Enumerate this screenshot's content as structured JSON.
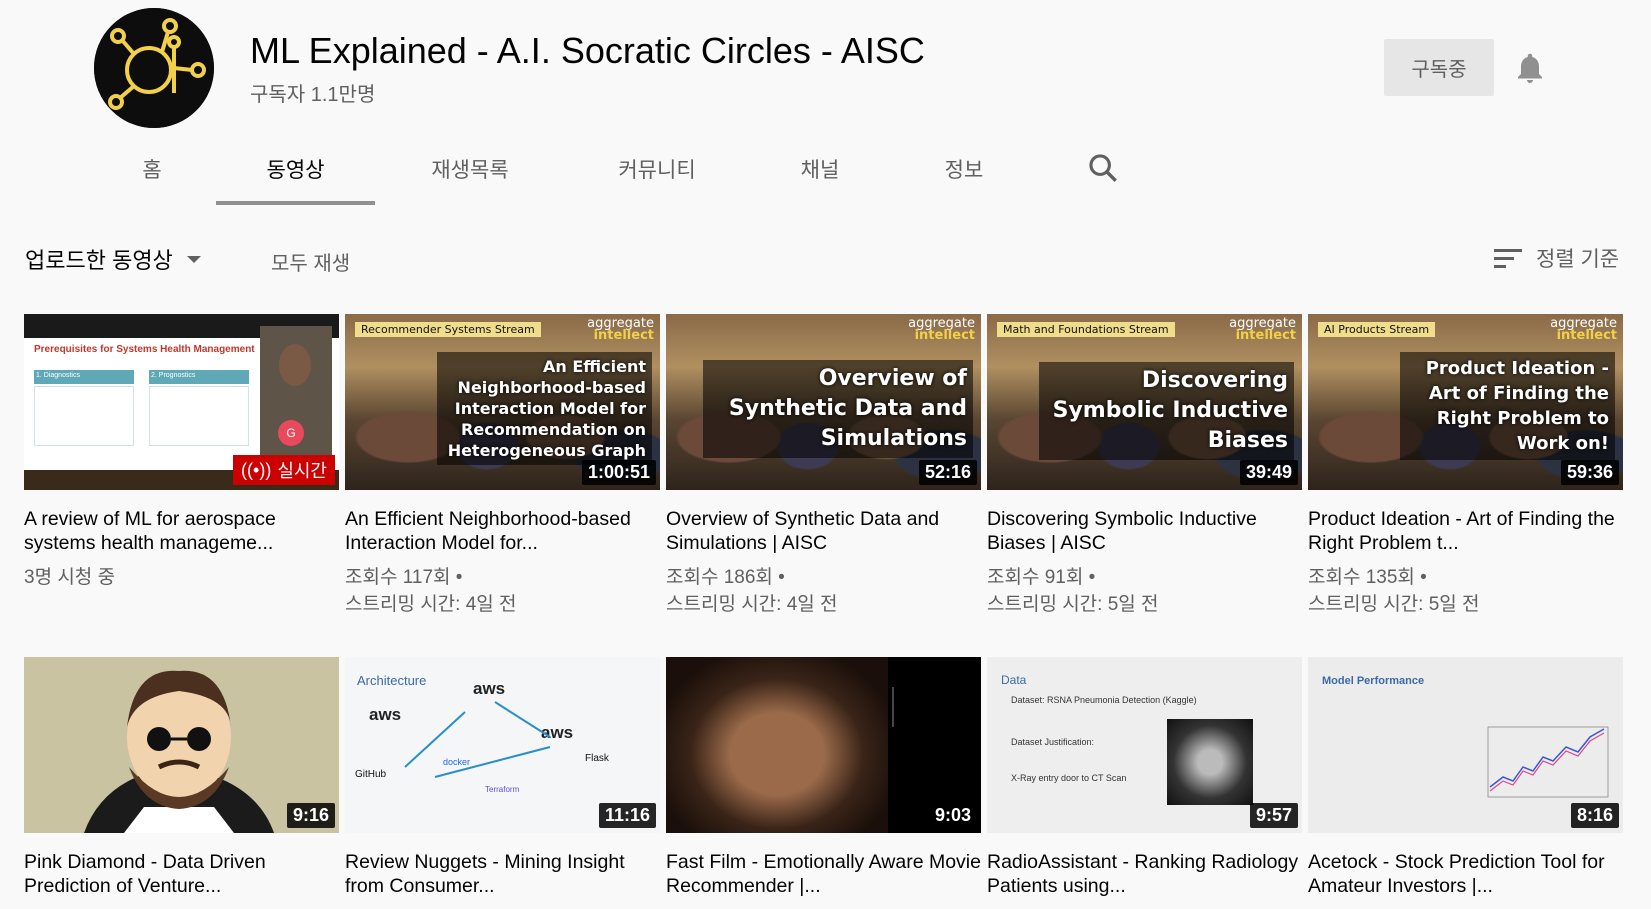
{
  "channel": {
    "title": "ML Explained - A.I. Socratic Circles - AISC",
    "subscribers": "구독자 1.1만명",
    "subscribe_label": "구독중"
  },
  "tabs": [
    {
      "label": "홈"
    },
    {
      "label": "동영상",
      "active": true
    },
    {
      "label": "재생목록"
    },
    {
      "label": "커뮤니티"
    },
    {
      "label": "채널"
    },
    {
      "label": "정보"
    }
  ],
  "section": {
    "title": "업로드한 동영상",
    "play_all": "모두 재생",
    "sort_label": "정렬 기준"
  },
  "videos": [
    {
      "title": "A review of ML for aerospace systems health manageme...",
      "meta1": "3명 시청 중",
      "meta2": "",
      "live": "실시간"
    },
    {
      "title": "An Efficient Neighborhood-based Interaction Model for...",
      "meta1": "조회수 117회 •",
      "meta2": "스트리밍 시간: 4일 전",
      "duration": "1:00:51",
      "stream": "Recommender Systems Stream",
      "overlay": "An Efficient Neighborhood-based Interaction Model for Recommendation on Heterogeneous Graph"
    },
    {
      "title": "Overview of Synthetic Data and Simulations | AISC",
      "meta1": "조회수 186회 •",
      "meta2": "스트리밍 시간: 4일 전",
      "duration": "52:16",
      "overlay": "Overview of Synthetic Data and Simulations"
    },
    {
      "title": "Discovering Symbolic Inductive Biases | AISC",
      "meta1": "조회수 91회 •",
      "meta2": "스트리밍 시간: 5일 전",
      "duration": "39:49",
      "stream": "Math and Foundations Stream",
      "overlay": "Discovering Symbolic Inductive Biases"
    },
    {
      "title": "Product Ideation - Art of Finding the Right Problem t...",
      "meta1": "조회수 135회 •",
      "meta2": "스트리밍 시간: 5일 전",
      "duration": "59:36",
      "stream": "AI Products Stream",
      "overlay": "Product Ideation - Art of Finding the Right Problem to Work on!"
    },
    {
      "title": "Pink Diamond - Data Driven Prediction of Venture...",
      "duration": "9:16"
    },
    {
      "title": "Review Nuggets - Mining Insight from Consumer...",
      "duration": "11:16"
    },
    {
      "title": "Fast Film - Emotionally Aware Movie Recommender |...",
      "duration": "9:03"
    },
    {
      "title": "RadioAssistant - Ranking Radiology Patients using...",
      "duration": "9:57"
    },
    {
      "title": "Acetock - Stock Prediction Tool for Amateur Investors |...",
      "duration": "8:16"
    }
  ],
  "thumb_text": {
    "slide1_heading": "Prerequisites for Systems Health Management",
    "slide1_col1": "1. Diagnostics",
    "slide1_col2": "2. Prognostics",
    "logo_line1": "aggregate",
    "logo_line2": "intellect",
    "arch_title": "Architecture",
    "data_title": "Data",
    "data_line1": "Dataset: RSNA Pneumonia Detection (Kaggle)",
    "data_line2": "Dataset Justification:",
    "data_line3": "X-Ray entry door to CT Scan",
    "model_title": "Model Performance",
    "aws": "aws",
    "github": "GitHub",
    "docker": "docker",
    "flask": "Flask",
    "terraform": "Terraform"
  },
  "colors": {
    "live_red": "#cc0000",
    "logo_gold": "#f2d04a"
  }
}
